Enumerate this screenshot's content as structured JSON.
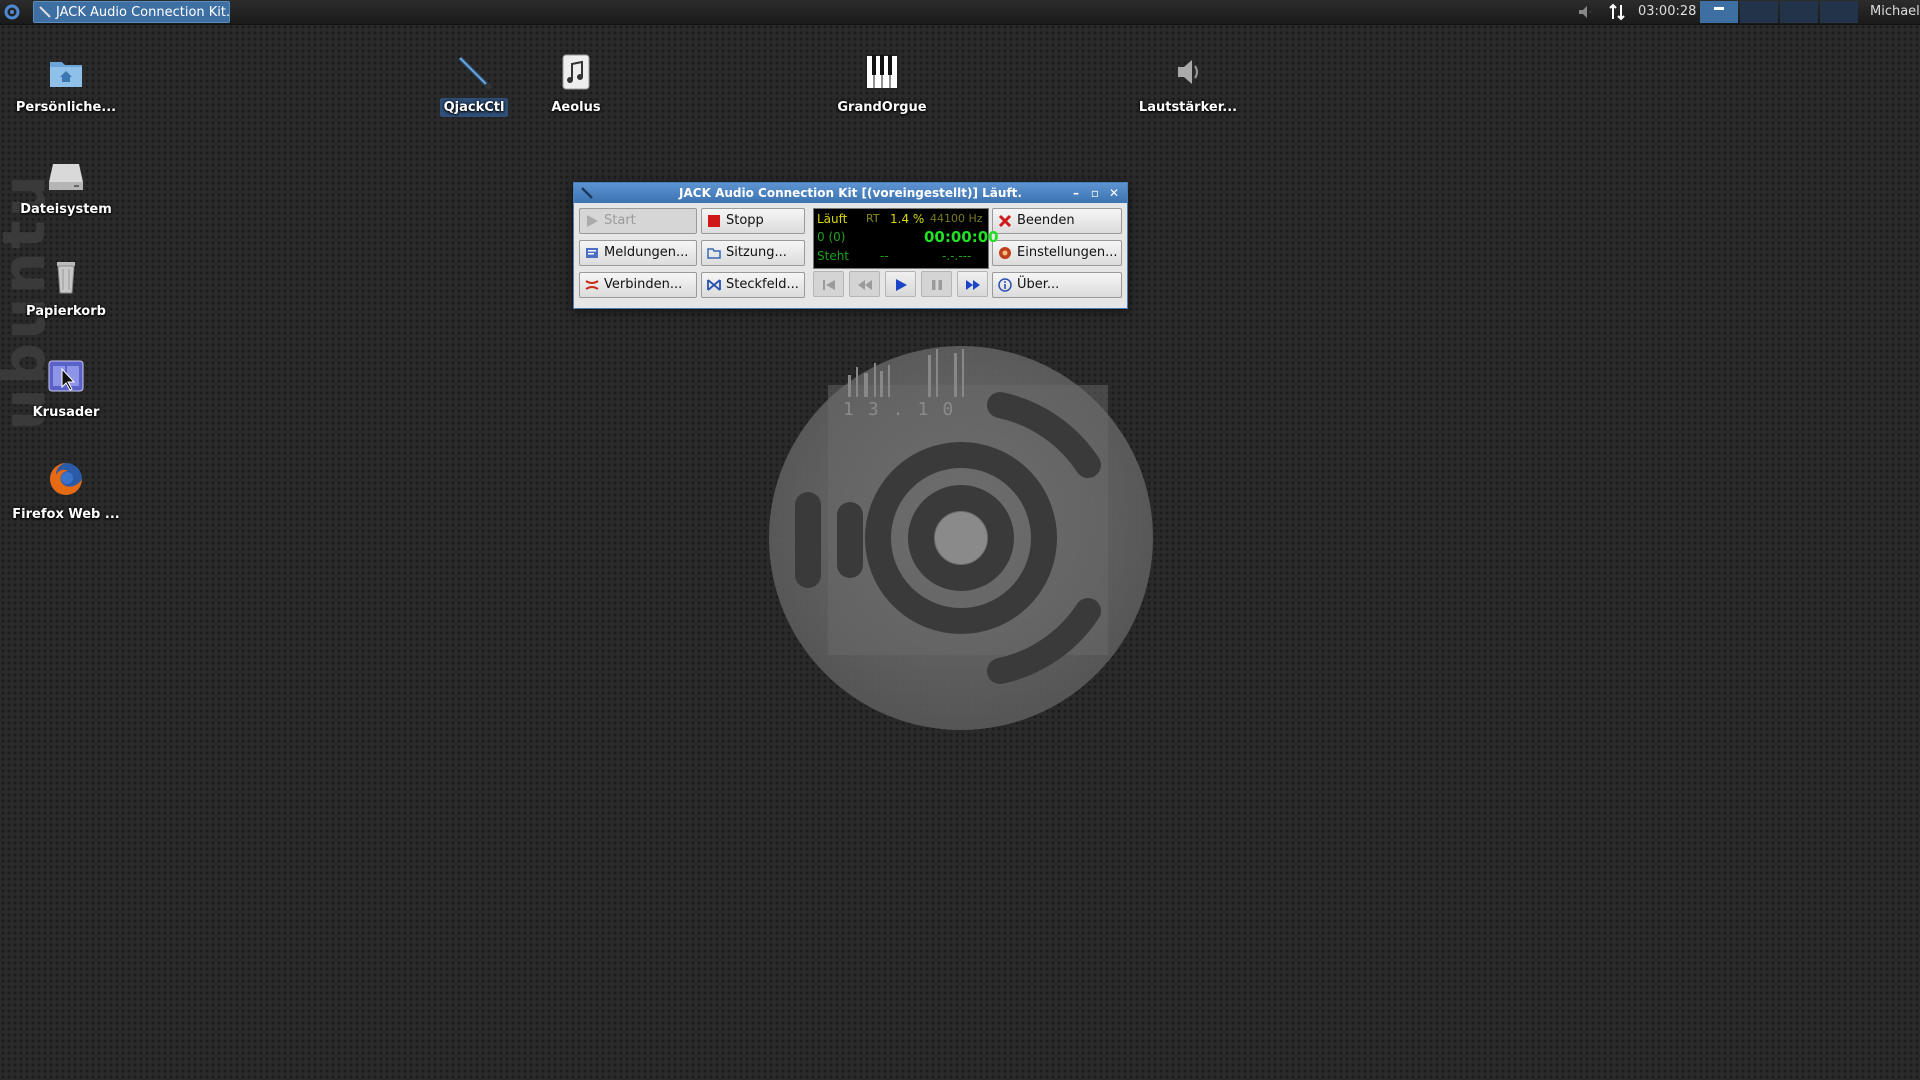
{
  "taskbar": {
    "task_title": "JACK Audio Connection Kit...",
    "clock": "03:00:28",
    "user": "Michael"
  },
  "desktop_icons": [
    {
      "label": "Persönliche..."
    },
    {
      "label": "Dateisystem"
    },
    {
      "label": "Papierkorb"
    },
    {
      "label": "Krusader"
    },
    {
      "label": "Firefox Web ..."
    },
    {
      "label": "QjackCtl"
    },
    {
      "label": "Aeolus"
    },
    {
      "label": "GrandOrgue"
    },
    {
      "label": "Lautstärker..."
    }
  ],
  "wallpaper": {
    "version_text": "13.10",
    "side_text": "ubuntu"
  },
  "jack_window": {
    "title": "JACK Audio Connection Kit [(voreingestellt)] Läuft.",
    "buttons": {
      "start": "Start",
      "stop": "Stopp",
      "quit": "Beenden",
      "messages": "Meldungen...",
      "session": "Sitzung...",
      "settings": "Einstellungen...",
      "connect": "Verbinden...",
      "patchbay": "Steckfeld...",
      "about": "Über..."
    },
    "status": {
      "state": "Läuft",
      "rt": "RT",
      "dsp_load": "1.4 %",
      "sample_rate": "44100 Hz",
      "xruns": "0 (0)",
      "time": "00:00:00",
      "transport": "Steht",
      "bpm": "--",
      "bbt": "-.-.---"
    }
  },
  "colors": {
    "accent": "#3d6fa3",
    "display_green": "#22e022",
    "display_yellow": "#d8d800"
  }
}
